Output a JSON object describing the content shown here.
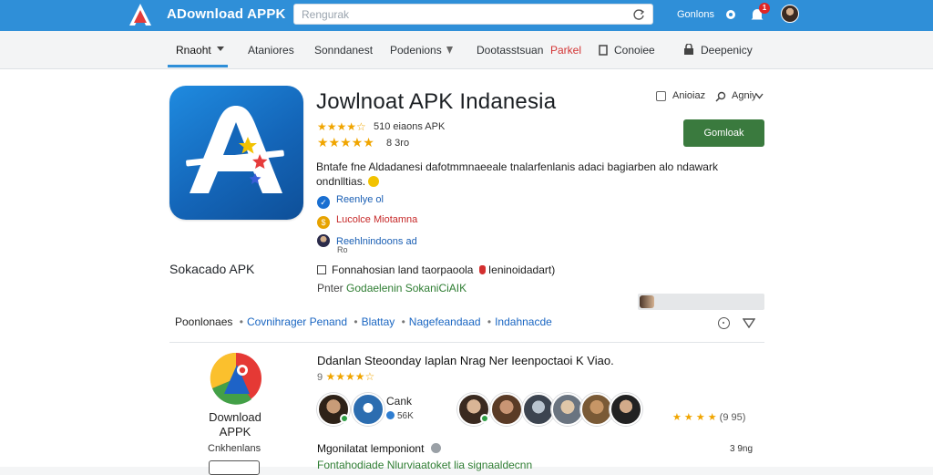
{
  "header": {
    "brand": "ADownload APPK",
    "search_placeholder": "Rengurak",
    "account_link": "Gonlons",
    "notification_count": "1"
  },
  "nav": {
    "items": [
      {
        "label": "Rnaoht"
      },
      {
        "label": "Ataniores"
      },
      {
        "label": "Sonndanest"
      },
      {
        "label": "Podenions"
      },
      {
        "label": "Dootasstsuan"
      },
      {
        "label": "Parkel"
      },
      {
        "label": "Conoiee"
      },
      {
        "label": "Deepenicy"
      }
    ]
  },
  "app": {
    "title": "Jowlnoat APK Indanesia",
    "rating_line_1": "510 eiaons APK",
    "rating_line_2": "8 3ro",
    "actions": {
      "save": "Anioiaz",
      "share": "Agniy"
    },
    "download_button": "Gomloak",
    "description": "Bntafe fne Aldadanesi dafotmmnaeeale tnalarfenlanis adaci bagiarben alo ndawark ondnlltias.",
    "features": [
      {
        "text": "Reenlye ol",
        "color": "#1a5fb4"
      },
      {
        "text": "Lucolce Miotamna",
        "color": "#c62828"
      },
      {
        "text": "Reehlnindoons ad",
        "color": "#1a5fb4"
      }
    ],
    "feature_extra": "Ro"
  },
  "section": {
    "title": "Sokacado APK",
    "note": "Fonnahosian land taorpaoola",
    "note_tail": "Ieninoidadart)",
    "green_prefix": "Pnter",
    "green_text": "Godaelenin SokaniCiAIK"
  },
  "breadcrumb": {
    "root": "Poonlonaes",
    "items": [
      "Covnihrager Penand",
      "Blattay",
      "Nagefeandaad",
      "Indahnacde"
    ]
  },
  "related": {
    "name": "Download APPK",
    "sub": "Cnkhenlans",
    "title": "Ddanlan Steoonday Iaplan Nrag Ner Ieenpoctaoi K Viao.",
    "stars_count": "9",
    "user_name": "Cank",
    "user_meta": "56K",
    "rating_right": "(9 95)",
    "more_title": "Mgonilatat lemponiont",
    "more_green": "Fontahodiade Nlurviaatoket lia signaaldecnn",
    "size": "3 9ng"
  },
  "colors": {
    "brand_blue": "#2f8fd8",
    "install_green": "#3a7a3e",
    "star": "#f0a500"
  }
}
